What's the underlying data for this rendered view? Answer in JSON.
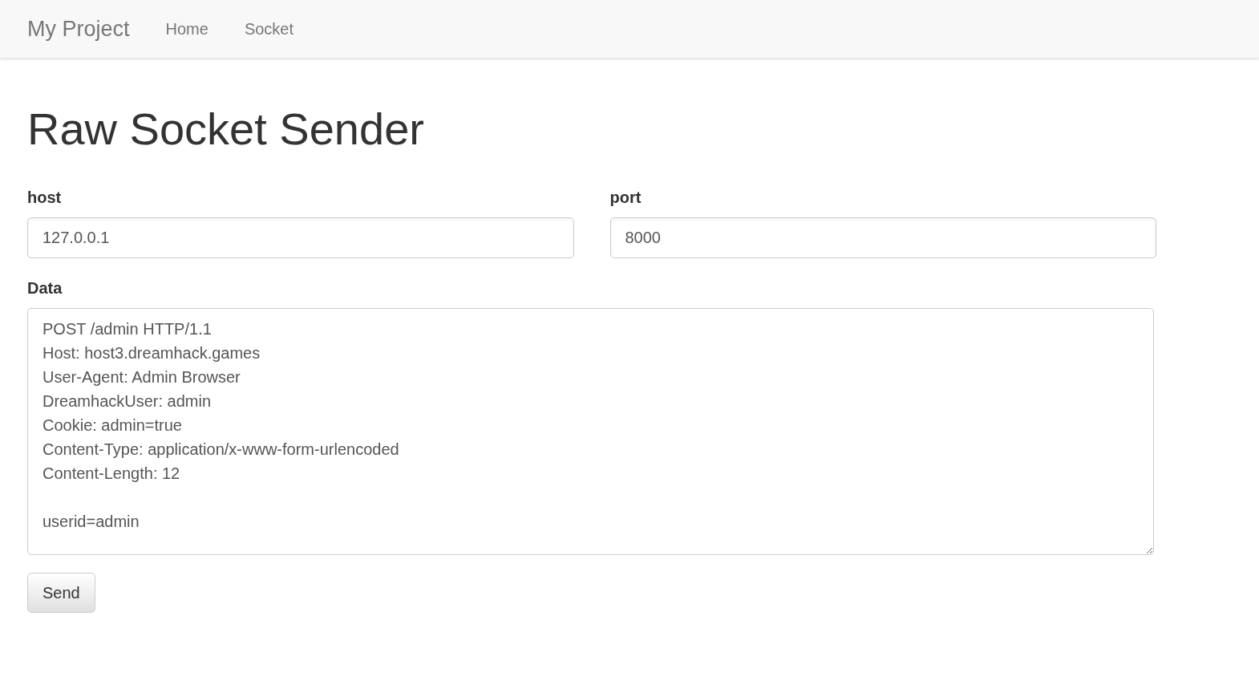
{
  "navbar": {
    "brand": "My Project",
    "links": [
      {
        "label": "Home",
        "selected": false
      },
      {
        "label": "Socket",
        "selected": false
      }
    ]
  },
  "page": {
    "title": "Raw Socket Sender"
  },
  "fields": [
    {
      "label": "host",
      "value": "127.0.0.1"
    },
    {
      "label": "port",
      "value": "8000"
    }
  ],
  "data": {
    "label": "Data",
    "value": "POST /admin HTTP/1.1\nHost: host3.dreamhack.games\nUser-Agent: Admin Browser\nDreamhackUser: admin\nCookie: admin=true\nContent-Type: application/x-www-form-urlencoded\nContent-Length: 12\n\nuserid=admin"
  },
  "button": {
    "label": "Send"
  }
}
